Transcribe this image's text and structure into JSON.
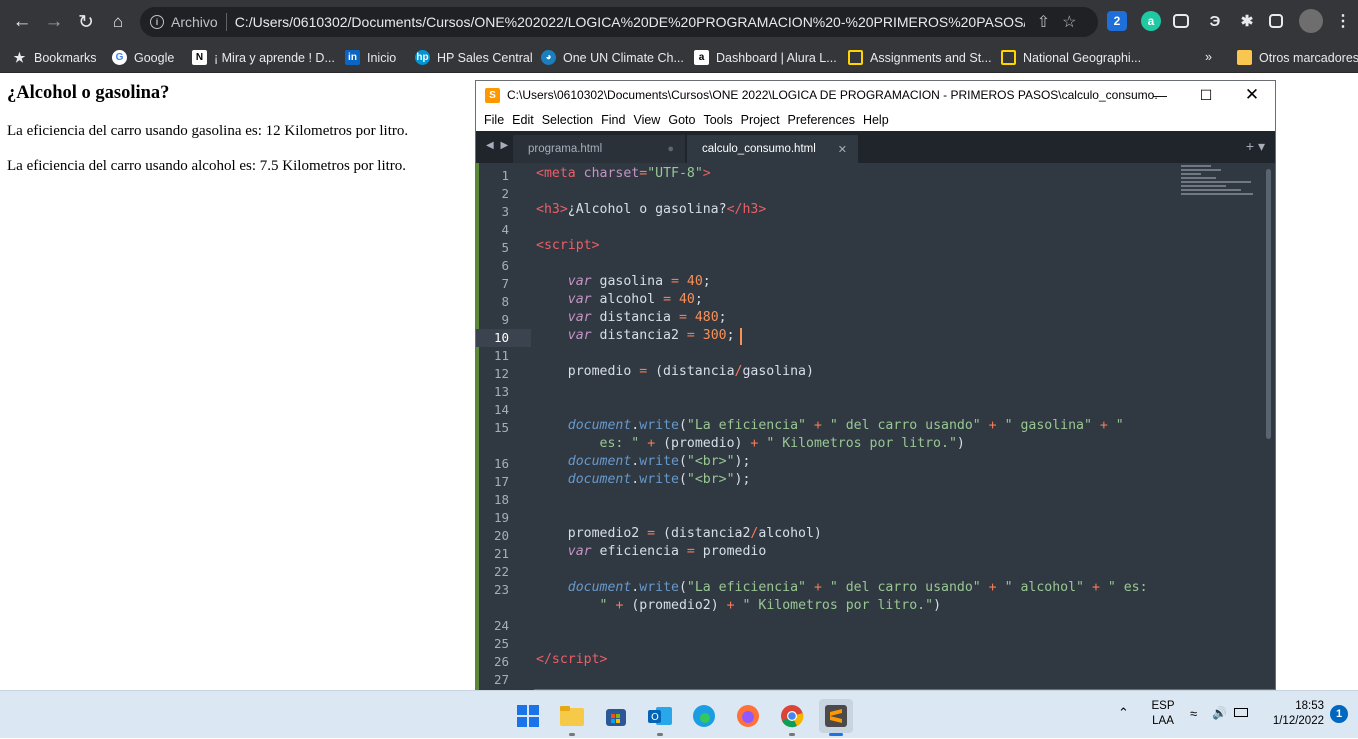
{
  "browser": {
    "omnibox_prefix": "Archivo",
    "url": "C:/Users/0610302/Documents/Cursos/ONE%202022/LOGICA%20DE%20PROGRAMACION%20-%20PRIMEROS%20PASOS/calc...",
    "bookmarks": [
      {
        "label": "Bookmarks",
        "icon": "star-icon"
      },
      {
        "label": "Google",
        "icon": "google-icon"
      },
      {
        "label": "¡ Mira y aprende ! D...",
        "icon": "ni-icon"
      },
      {
        "label": "Inicio",
        "icon": "linkedin-icon"
      },
      {
        "label": "HP Sales Central",
        "icon": "hp-icon"
      },
      {
        "label": "One UN Climate Ch...",
        "icon": "un-icon"
      },
      {
        "label": "Dashboard | Alura L...",
        "icon": "alura-icon"
      },
      {
        "label": "Assignments and St...",
        "icon": "folder-icon"
      },
      {
        "label": "National Geographi...",
        "icon": "natgeo-icon"
      }
    ],
    "overflow_label": "»",
    "other_bookmarks": "Otros marcadores"
  },
  "page": {
    "heading": "¿Alcohol o gasolina?",
    "line1": "La eficiencia del carro usando gasolina es: 12 Kilometros por litro.",
    "line2": "La eficiencia del carro usando alcohol es: 7.5 Kilometros por litro."
  },
  "editor": {
    "title": "C:\\Users\\0610302\\Documents\\Cursos\\ONE 2022\\LOGICA DE PROGRAMACION - PRIMEROS PASOS\\calculo_consumo....",
    "menu": [
      "File",
      "Edit",
      "Selection",
      "Find",
      "View",
      "Goto",
      "Tools",
      "Project",
      "Preferences",
      "Help"
    ],
    "tabs": [
      {
        "label": "programa.html",
        "active": false
      },
      {
        "label": "calculo_consumo.html",
        "active": true
      }
    ],
    "current_line": 10,
    "line_numbers": [
      "1",
      "2",
      "3",
      "4",
      "5",
      "6",
      "7",
      "8",
      "9",
      "10",
      "11",
      "12",
      "13",
      "14",
      "15",
      "",
      "16",
      "17",
      "18",
      "19",
      "20",
      "21",
      "22",
      "23",
      "",
      "24",
      "25",
      "26",
      "27"
    ]
  },
  "taskbar": {
    "apps": [
      "windows-start-icon",
      "file-explorer-icon",
      "store-icon",
      "outlook-icon",
      "edge-icon",
      "firefox-icon",
      "chrome-icon",
      "sublime-icon"
    ],
    "lang_top": "ESP",
    "lang_bottom": "LAA",
    "time": "18:53",
    "date": "1/12/2022",
    "notification_count": "1"
  },
  "colors": {
    "browser_chrome": "#35363a",
    "editor_bg": "#303841",
    "taskbar": "#dbe7f2",
    "sublime_orange": "#ff9800"
  }
}
